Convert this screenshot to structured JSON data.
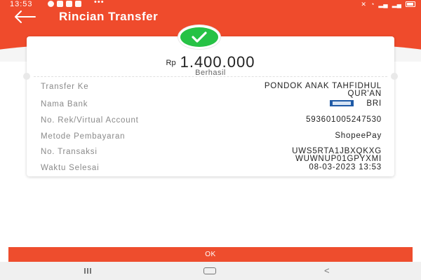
{
  "status_bar": {
    "time": "13:53",
    "more": "•••"
  },
  "header": {
    "title": "Rincian Transfer"
  },
  "transfer": {
    "currency": "Rp",
    "amount": "1.400.000",
    "status": "Berhasil"
  },
  "details": [
    {
      "label": "Transfer Ke",
      "value_line1": "PONDOK ANAK TAHFIDHUL",
      "value_line2": "QUR'AN"
    },
    {
      "label": "Nama Bank",
      "value": "BRI"
    },
    {
      "label": "No. Rek/Virtual Account",
      "value": "593601005247530"
    },
    {
      "label": "Metode Pembayaran",
      "value": "ShopeePay"
    },
    {
      "label": "No. Transaksi",
      "value_line1": "UWS5RTA1JBXQKXG",
      "value_line2": "WUWNUP01GPYXMI"
    },
    {
      "label": "Waktu Selesai",
      "value": "08-03-2023 13:53"
    }
  ],
  "ok_button": "OK",
  "colors": {
    "brand": "#ee4d2d",
    "success": "#26c245"
  }
}
